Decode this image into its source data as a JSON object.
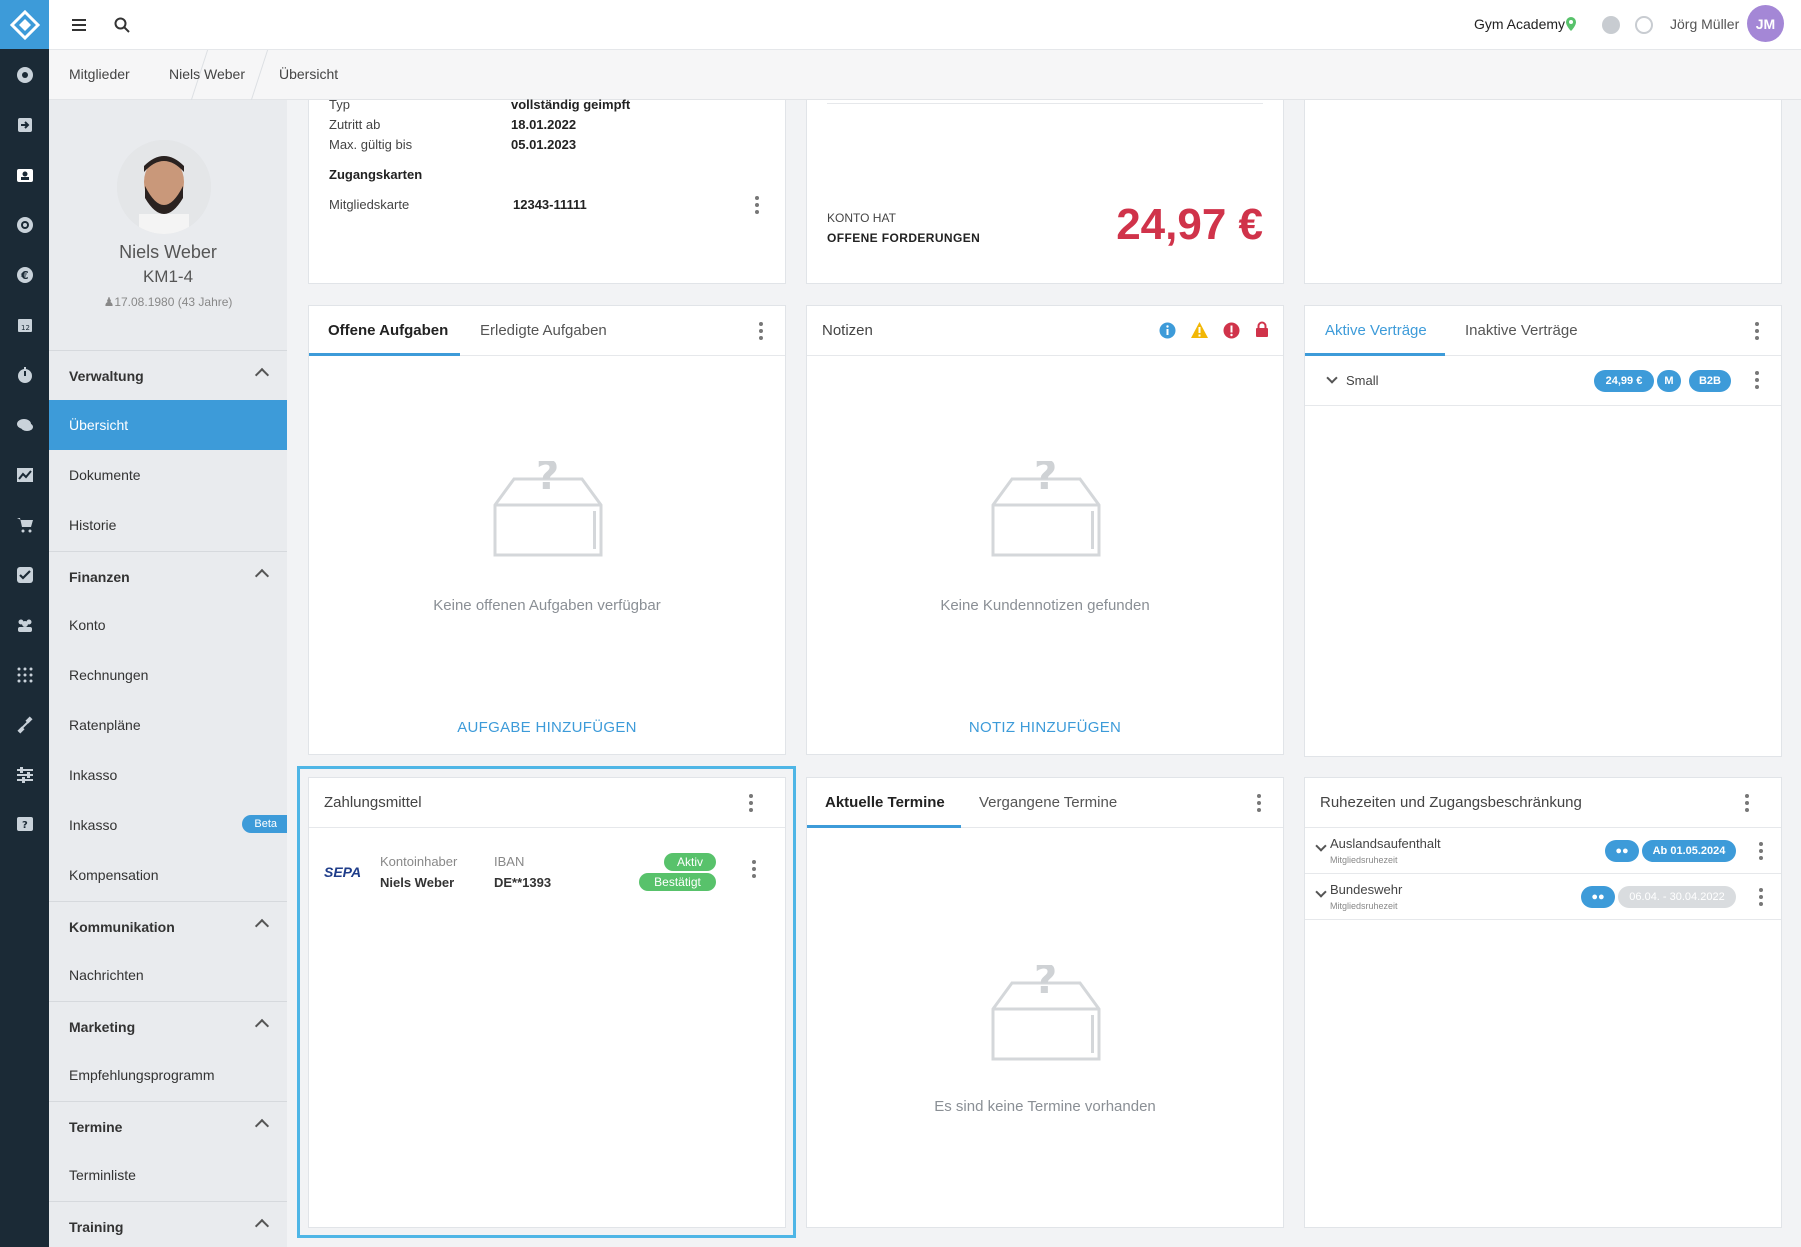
{
  "topbar": {
    "studio": "Gym Academy",
    "user": "Jörg Müller",
    "user_initials": "JM"
  },
  "breadcrumb": [
    "Mitglieder",
    "Niels Weber",
    "Übersicht"
  ],
  "profile": {
    "name": "Niels Weber",
    "code": "KM1-4",
    "birth": "17.08.1980 (43 Jahre)"
  },
  "sidebar": {
    "verwaltung": "Verwaltung",
    "uebersicht": "Übersicht",
    "dokumente": "Dokumente",
    "historie": "Historie",
    "finanzen": "Finanzen",
    "konto": "Konto",
    "rechnungen": "Rechnungen",
    "ratenplaene": "Ratenpläne",
    "inkasso1": "Inkasso",
    "inkasso2": "Inkasso",
    "beta": "Beta",
    "kompensation": "Kompensation",
    "kommunikation": "Kommunikation",
    "nachrichten": "Nachrichten",
    "marketing": "Marketing",
    "empfehlung": "Empfehlungsprogramm",
    "termine": "Termine",
    "terminliste": "Terminliste",
    "training": "Training"
  },
  "access": {
    "typ_label": "Typ",
    "typ_value": "vollständig geimpft",
    "zutritt_label": "Zutritt ab",
    "zutritt_value": "18.01.2022",
    "max_label": "Max. gültig bis",
    "max_value": "05.01.2023",
    "cards_title": "Zugangskarten",
    "card_label": "Mitgliedskarte",
    "card_value": "12343-11111"
  },
  "account": {
    "line1": "KONTO HAT",
    "line2": "OFFENE FORDERUNGEN",
    "amount": "24,97 €"
  },
  "tasks": {
    "tab1": "Offene Aufgaben",
    "tab2": "Erledigte Aufgaben",
    "empty": "Keine offenen Aufgaben verfügbar",
    "add": "AUFGABE HINZUFÜGEN"
  },
  "notes": {
    "title": "Notizen",
    "empty": "Keine Kundennotizen gefunden",
    "add": "NOTIZ HINZUFÜGEN"
  },
  "contracts": {
    "tab1": "Aktive Verträge",
    "tab2": "Inaktive Verträge",
    "row_name": "Small",
    "price": "24,99 €",
    "m": "M",
    "b2b": "B2B"
  },
  "payment": {
    "title": "Zahlungsmittel",
    "logo": "SEPA",
    "holder_label": "Kontoinhaber",
    "holder_value": "Niels Weber",
    "iban_label": "IBAN",
    "iban_value": "DE**1393",
    "status1": "Aktiv",
    "status2": "Bestätigt"
  },
  "appointments": {
    "tab1": "Aktuelle Termine",
    "tab2": "Vergangene Termine",
    "empty": "Es sind keine Termine vorhanden"
  },
  "rest": {
    "title": "Ruhezeiten und Zugangsbeschränkung",
    "row1_name": "Auslandsaufenthalt",
    "row1_sub": "Mitgliedsruhezeit",
    "row1_date": "Ab 01.05.2024",
    "row2_name": "Bundeswehr",
    "row2_sub": "Mitgliedsruhezeit",
    "row2_date": "06.04. - 30.04.2022"
  },
  "colors": {
    "accent": "#3d9bd9",
    "danger": "#d0334a",
    "success": "#58c26b",
    "rail": "#1b2a36"
  }
}
